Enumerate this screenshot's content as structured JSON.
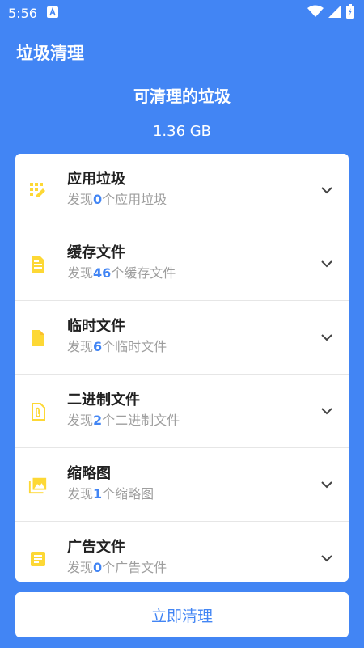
{
  "status_bar": {
    "time": "5:56"
  },
  "header": {
    "title": "垃圾清理",
    "summary_title": "可清理的垃圾",
    "summary_size": "1.36 GB"
  },
  "items": [
    {
      "title": "应用垃圾",
      "prefix": "发现",
      "count": "0",
      "suffix": "个应用垃圾",
      "icon": "grid-edit-icon"
    },
    {
      "title": "缓存文件",
      "prefix": "发现",
      "count": "46",
      "suffix": "个缓存文件",
      "icon": "document-icon"
    },
    {
      "title": "临时文件",
      "prefix": "发现",
      "count": "6",
      "suffix": "个临时文件",
      "icon": "file-icon"
    },
    {
      "title": "二进制文件",
      "prefix": "发现",
      "count": "2",
      "suffix": "个二进制文件",
      "icon": "paperclip-file-icon"
    },
    {
      "title": "缩略图",
      "prefix": "发现",
      "count": "1",
      "suffix": "个缩略图",
      "icon": "image-icon"
    },
    {
      "title": "广告文件",
      "prefix": "发现",
      "count": "0",
      "suffix": "个广告文件",
      "icon": "notes-icon"
    }
  ],
  "action": {
    "clean_label": "立即清理"
  },
  "colors": {
    "primary": "#4285F4",
    "icon": "#FDD835",
    "background": "#FFFFFF"
  }
}
